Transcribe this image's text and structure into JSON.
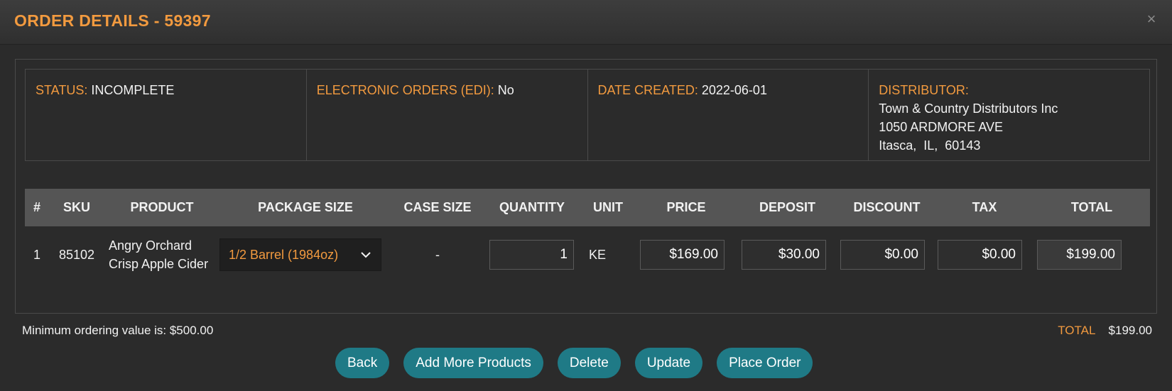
{
  "modal": {
    "title": "ORDER DETAILS - 59397",
    "close": "×"
  },
  "info": {
    "status_label": "STATUS:",
    "status_value": "INCOMPLETE",
    "edi_label": "ELECTRONIC ORDERS (EDI):",
    "edi_value": "No",
    "date_label": "DATE CREATED:",
    "date_value": "2022-06-01",
    "distributor_label": "DISTRIBUTOR:",
    "distributor_name": "Town & Country Distributors Inc",
    "distributor_address1": "1050 ARDMORE AVE",
    "distributor_address2": "Itasca,  IL,  60143"
  },
  "table": {
    "headers": [
      "#",
      "SKU",
      "PRODUCT",
      "PACKAGE SIZE",
      "CASE SIZE",
      "QUANTITY",
      "UNIT",
      "PRICE",
      "DEPOSIT",
      "DISCOUNT",
      "TAX",
      "TOTAL"
    ],
    "rows": [
      {
        "num": "1",
        "sku": "85102",
        "product_line1": "Angry Orchard",
        "product_line2": "Crisp Apple Cider",
        "package_size": "1/2 Barrel (1984oz)",
        "case_size": "-",
        "quantity": "1",
        "unit": "KE",
        "price": "$169.00",
        "deposit": "$30.00",
        "discount": "$0.00",
        "tax": "$0.00",
        "total": "$199.00"
      }
    ]
  },
  "footer": {
    "min_order": "Minimum ordering value is: $500.00",
    "total_label": "TOTAL",
    "total_value": "$199.00"
  },
  "buttons": {
    "back": "Back",
    "add_more": "Add More Products",
    "delete": "Delete",
    "update": "Update",
    "place_order": "Place Order"
  },
  "colors": {
    "accent": "#f29a3f",
    "button": "#1f7a86",
    "background": "#2b2b2b"
  }
}
